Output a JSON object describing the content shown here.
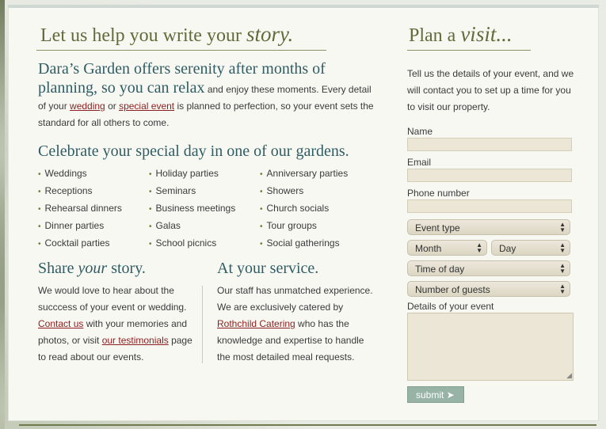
{
  "left": {
    "heading_plain": "Let us help you write your ",
    "heading_script": "story.",
    "intro": {
      "lead": "Dara’s Garden offers serenity after months of planning, so you can relax",
      "text1": " and enjoy these moments. Every detail of your ",
      "link_wedding": "wedding",
      "text2": " or ",
      "link_special_event": "special event",
      "text3": " is planned to perfection, so your event sets the standard for all others to come."
    },
    "celebrate_heading": "Celebrate your special day in one of our gardens.",
    "events_col1": [
      "Weddings",
      "Receptions",
      "Rehearsal dinners",
      "Dinner parties",
      "Cocktail parties"
    ],
    "events_col2": [
      "Holiday parties",
      "Seminars",
      "Business meetings",
      "Galas",
      "School picnics"
    ],
    "events_col3": [
      "Anniversary parties",
      "Showers",
      "Church socials",
      "Tour groups",
      "Social gatherings"
    ],
    "share": {
      "heading_plain1": "Share ",
      "heading_italic": "your",
      "heading_plain2": " story.",
      "text1": "We would love to hear about the succcess of your event or wedding. ",
      "link_contact": "Contact us",
      "text2": " with your memories and photos, or visit ",
      "link_testimonials": "our testimonials",
      "text3": " page to read about our events."
    },
    "service": {
      "heading": "At your service.",
      "text1": "Our staff has unmatched experience. We are exclusively catered by ",
      "link_catering": "Rothchild Catering",
      "text2": " who has the knowledge and expertise to handle the most detailed meal requests."
    }
  },
  "right": {
    "heading_plain": "Plan a ",
    "heading_script": "visit...",
    "intro": "Tell us the details of your event, and we will contact you to set up a time for you to visit our property.",
    "name_label": "Name",
    "email_label": "Email",
    "phone_label": "Phone number",
    "event_type": "Event type",
    "month": "Month",
    "day": "Day",
    "time_of_day": "Time of day",
    "guests": "Number of guests",
    "details_label": "Details of your event",
    "submit": "submit ➤"
  }
}
